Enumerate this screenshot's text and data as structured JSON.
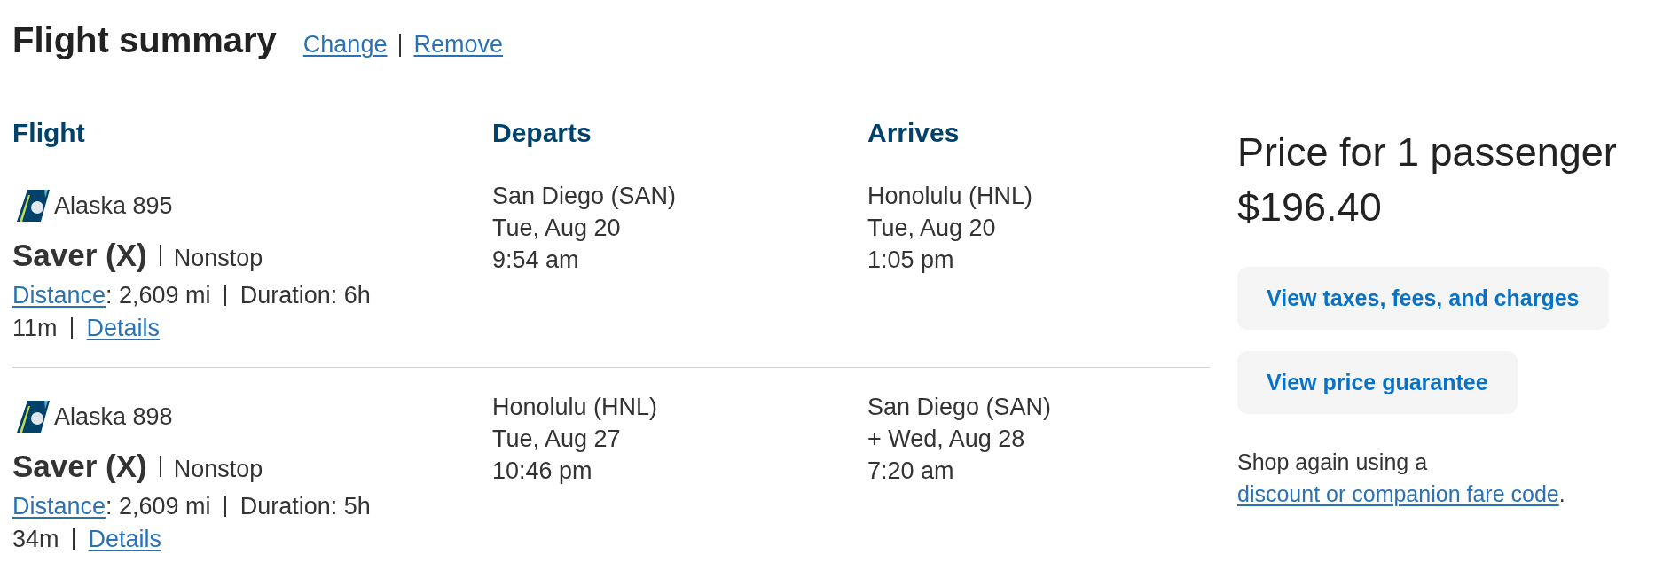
{
  "header": {
    "title": "Flight summary",
    "links": [
      "Change",
      "Remove"
    ]
  },
  "table": {
    "columns": [
      "Flight",
      "Departs",
      "Arrives"
    ],
    "rows": [
      {
        "airline": "Alaska 895",
        "fare": "Saver (X)",
        "stops": "Nonstop",
        "distance_link": "Distance",
        "distance_value": ": 2,609 mi",
        "duration": "Duration: 6h 11m",
        "details_link": "Details",
        "departs": {
          "airport": "San Diego (SAN)",
          "date": "Tue, Aug 20",
          "time": "9:54 am"
        },
        "arrives": {
          "airport": "Honolulu (HNL)",
          "date": "Tue, Aug 20",
          "time": "1:05 pm"
        }
      },
      {
        "airline": "Alaska 898",
        "fare": "Saver (X)",
        "stops": "Nonstop",
        "distance_link": "Distance",
        "distance_value": ": 2,609 mi",
        "duration": "Duration: 5h 34m",
        "details_link": "Details",
        "departs": {
          "airport": "Honolulu (HNL)",
          "date": "Tue, Aug 27",
          "time": "10:46 pm"
        },
        "arrives": {
          "airport": "San Diego (SAN)",
          "date": "+ Wed, Aug 28",
          "time": "7:20 am"
        }
      }
    ]
  },
  "price": {
    "title": "Price for 1 passenger",
    "amount": "$196.40",
    "buttons": [
      "View taxes, fees, and charges",
      "View price guarantee"
    ],
    "shop_again": {
      "text": "Shop again using a",
      "link": "discount or companion fare code",
      "end": "."
    }
  }
}
